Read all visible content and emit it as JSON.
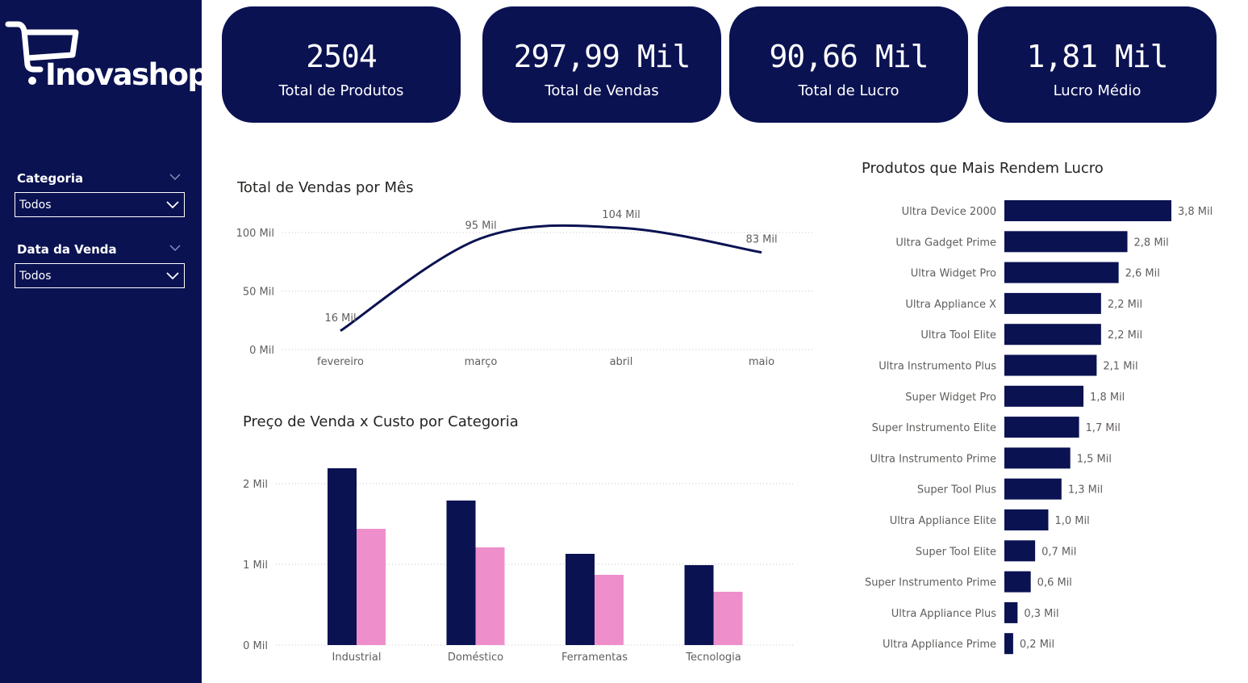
{
  "brand": {
    "name": "Inovashop"
  },
  "filters": [
    {
      "title": "Categoria",
      "value": "Todos"
    },
    {
      "title": "Data da Venda",
      "value": "Todos"
    }
  ],
  "kpis": [
    {
      "value": "2504",
      "label": "Total de Produtos"
    },
    {
      "value": "297,99 Mil",
      "label": "Total de Vendas"
    },
    {
      "value": "90,66 Mil",
      "label": "Total de Lucro"
    },
    {
      "value": "1,81 Mil",
      "label": "Lucro Médio"
    }
  ],
  "colors": {
    "navy": "#0a1252",
    "pink": "#ee8fcc",
    "grid": "#c8c6c4",
    "text": "#605e5c"
  },
  "chart_data": [
    {
      "type": "line",
      "title": "Total de Vendas por Mês",
      "categories": [
        "fevereiro",
        "março",
        "abril",
        "maio"
      ],
      "values": [
        16,
        95,
        104,
        83
      ],
      "data_labels": [
        "16 Mil",
        "95 Mil",
        "104 Mil",
        "83 Mil"
      ],
      "yticks": [
        "0 Mil",
        "50 Mil",
        "100 Mil"
      ],
      "ylim": [
        0,
        100
      ],
      "grid": true
    },
    {
      "type": "bar",
      "title": "Preço de Venda x Custo por Categoria",
      "categories": [
        "Industrial",
        "Doméstico",
        "Ferramentas",
        "Tecnologia"
      ],
      "series": [
        {
          "values": [
            2.19,
            1.79,
            1.13,
            0.99
          ],
          "color": "#0a1252"
        },
        {
          "values": [
            1.44,
            1.21,
            0.87,
            0.66
          ],
          "color": "#ee8fcc"
        }
      ],
      "yticks": [
        "0 Mil",
        "1 Mil",
        "2 Mil"
      ],
      "ylim": [
        0,
        2
      ],
      "grid": true
    },
    {
      "type": "bar",
      "orientation": "horizontal",
      "title": "Produtos que Mais Rendem Lucro",
      "categories": [
        "Ultra Device 2000",
        "Ultra Gadget Prime",
        "Ultra Widget Pro",
        "Ultra Appliance X",
        "Ultra Tool Elite",
        "Ultra Instrumento Plus",
        "Super Widget Pro",
        "Super Instrumento Elite",
        "Ultra Instrumento Prime",
        "Super Tool Plus",
        "Ultra Appliance Elite",
        "Super Tool Elite",
        "Super Instrumento Prime",
        "Ultra Appliance Plus",
        "Ultra Appliance Prime"
      ],
      "values": [
        3.8,
        2.8,
        2.6,
        2.2,
        2.2,
        2.1,
        1.8,
        1.7,
        1.5,
        1.3,
        1.0,
        0.7,
        0.6,
        0.3,
        0.2
      ],
      "data_labels": [
        "3,8 Mil",
        "2,8 Mil",
        "2,6 Mil",
        "2,2 Mil",
        "2,2 Mil",
        "2,1 Mil",
        "1,8 Mil",
        "1,7 Mil",
        "1,5 Mil",
        "1,3 Mil",
        "1,0 Mil",
        "0,7 Mil",
        "0,6 Mil",
        "0,3 Mil",
        "0,2 Mil"
      ]
    }
  ]
}
